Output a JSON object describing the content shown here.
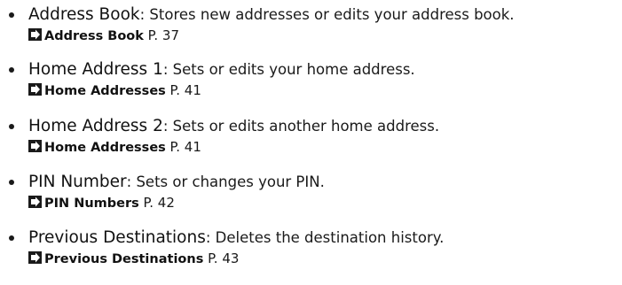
{
  "items": [
    {
      "term": "Address Book",
      "description": ": Stores new addresses or edits your address book.",
      "ref_title": "Address Book",
      "ref_page": " P. 37"
    },
    {
      "term": "Home Address 1",
      "description": ": Sets or edits your home address.",
      "ref_title": "Home Addresses",
      "ref_page": " P. 41"
    },
    {
      "term": "Home Address 2",
      "description": ": Sets or edits another home address.",
      "ref_title": "Home Addresses",
      "ref_page": " P. 41"
    },
    {
      "term": "PIN Number",
      "description": ": Sets or changes your PIN.",
      "ref_title": "PIN Numbers",
      "ref_page": " P. 42"
    },
    {
      "term": "Previous Destinations",
      "description": ": Deletes the destination history.",
      "ref_title": "Previous Destinations",
      "ref_page": " P. 43"
    }
  ],
  "icons": {
    "reference_arrow": "reference-arrow-icon"
  },
  "colors": {
    "text": "#1a1a1a",
    "background": "#ffffff"
  }
}
